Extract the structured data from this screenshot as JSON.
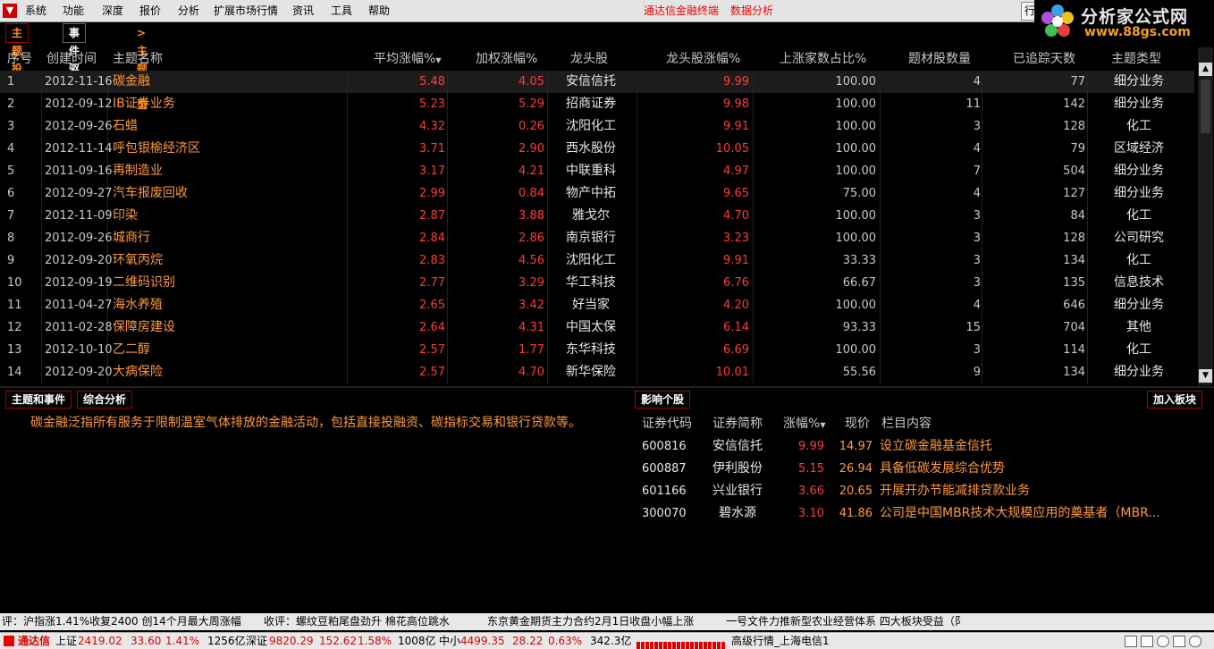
{
  "menubar": {
    "items": [
      "系统",
      "功能",
      "深度",
      "报价",
      "分析",
      "扩展市场行情",
      "资讯",
      "工具",
      "帮助"
    ],
    "center_title": "通达信金融终端",
    "center_sub": "数据分析",
    "hangqing": "行"
  },
  "brand": {
    "name": "分析家公式网",
    "url": "www.88gs.com"
  },
  "tabs": {
    "theme_invest": "主题投资",
    "event_driven": "事件驱动",
    "theme_type": ">主题类型"
  },
  "table": {
    "headers": [
      "序号",
      "创建时间",
      "主题名称",
      "平均涨幅%",
      "加权涨幅%",
      "龙头股",
      "龙头股涨幅%",
      "上涨家数占比%",
      "题材股数量",
      "已追踪天数",
      "主题类型"
    ],
    "rows": [
      {
        "no": "1",
        "date": "2012-11-16",
        "name": "碳金融",
        "avg": "5.48",
        "wavg": "4.05",
        "lead": "安信信托",
        "lead_pct": "9.99",
        "up_ratio": "100.00",
        "count": "4",
        "days": "77",
        "type": "细分业务"
      },
      {
        "no": "2",
        "date": "2012-09-12",
        "name": "IB证券业务",
        "avg": "5.23",
        "wavg": "5.29",
        "lead": "招商证券",
        "lead_pct": "9.98",
        "up_ratio": "100.00",
        "count": "11",
        "days": "142",
        "type": "细分业务"
      },
      {
        "no": "3",
        "date": "2012-09-26",
        "name": "石蜡",
        "avg": "4.32",
        "wavg": "0.26",
        "lead": "沈阳化工",
        "lead_pct": "9.91",
        "up_ratio": "100.00",
        "count": "3",
        "days": "128",
        "type": "化工"
      },
      {
        "no": "4",
        "date": "2012-11-14",
        "name": "呼包银榆经济区",
        "avg": "3.71",
        "wavg": "2.90",
        "lead": "西水股份",
        "lead_pct": "10.05",
        "up_ratio": "100.00",
        "count": "4",
        "days": "79",
        "type": "区域经济"
      },
      {
        "no": "5",
        "date": "2011-09-16",
        "name": "再制造业",
        "avg": "3.17",
        "wavg": "4.21",
        "lead": "中联重科",
        "lead_pct": "4.97",
        "up_ratio": "100.00",
        "count": "7",
        "days": "504",
        "type": "细分业务"
      },
      {
        "no": "6",
        "date": "2012-09-27",
        "name": "汽车报废回收",
        "avg": "2.99",
        "wavg": "0.84",
        "lead": "物产中拓",
        "lead_pct": "9.65",
        "up_ratio": "75.00",
        "count": "4",
        "days": "127",
        "type": "细分业务"
      },
      {
        "no": "7",
        "date": "2012-11-09",
        "name": "印染",
        "avg": "2.87",
        "wavg": "3.88",
        "lead": "雅戈尔",
        "lead_pct": "4.70",
        "up_ratio": "100.00",
        "count": "3",
        "days": "84",
        "type": "化工"
      },
      {
        "no": "8",
        "date": "2012-09-26",
        "name": "城商行",
        "avg": "2.84",
        "wavg": "2.86",
        "lead": "南京银行",
        "lead_pct": "3.23",
        "up_ratio": "100.00",
        "count": "3",
        "days": "128",
        "type": "公司研究"
      },
      {
        "no": "9",
        "date": "2012-09-20",
        "name": "环氧丙烷",
        "avg": "2.83",
        "wavg": "4.56",
        "lead": "沈阳化工",
        "lead_pct": "9.91",
        "up_ratio": "33.33",
        "count": "3",
        "days": "134",
        "type": "化工"
      },
      {
        "no": "10",
        "date": "2012-09-19",
        "name": "二维码识别",
        "avg": "2.77",
        "wavg": "3.29",
        "lead": "华工科技",
        "lead_pct": "6.76",
        "up_ratio": "66.67",
        "count": "3",
        "days": "135",
        "type": "信息技术"
      },
      {
        "no": "11",
        "date": "2011-04-27",
        "name": "海水养殖",
        "avg": "2.65",
        "wavg": "3.42",
        "lead": "好当家",
        "lead_pct": "4.20",
        "up_ratio": "100.00",
        "count": "4",
        "days": "646",
        "type": "细分业务"
      },
      {
        "no": "12",
        "date": "2011-02-28",
        "name": "保障房建设",
        "avg": "2.64",
        "wavg": "4.31",
        "lead": "中国太保",
        "lead_pct": "6.14",
        "up_ratio": "93.33",
        "count": "15",
        "days": "704",
        "type": "其他"
      },
      {
        "no": "13",
        "date": "2012-10-10",
        "name": "乙二醇",
        "avg": "2.57",
        "wavg": "1.77",
        "lead": "东华科技",
        "lead_pct": "6.69",
        "up_ratio": "100.00",
        "count": "3",
        "days": "114",
        "type": "化工"
      },
      {
        "no": "14",
        "date": "2012-09-20",
        "name": "大病保险",
        "avg": "2.57",
        "wavg": "4.70",
        "lead": "新华保险",
        "lead_pct": "10.01",
        "up_ratio": "55.56",
        "count": "9",
        "days": "134",
        "type": "细分业务"
      }
    ]
  },
  "bottom_tabs": {
    "theme_event": "主题和事件",
    "analysis": "综合分析",
    "impact": "影响个股",
    "add_block": "加入板块"
  },
  "description": "碳金融泛指所有服务于限制温室气体排放的金融活动，包括直接投融资、碳指标交易和银行贷款等。",
  "impact": {
    "headers": [
      "证券代码",
      "证券简称",
      "涨幅%",
      "现价",
      "栏目内容"
    ],
    "rows": [
      {
        "code": "600816",
        "name": "安信信托",
        "pct": "9.99",
        "price": "14.97",
        "content": "设立碳金融基金信托"
      },
      {
        "code": "600887",
        "name": "伊利股份",
        "pct": "5.15",
        "price": "26.94",
        "content": "具备低碳发展综合优势"
      },
      {
        "code": "601166",
        "name": "兴业银行",
        "pct": "3.66",
        "price": "20.65",
        "content": "开展开办节能减排贷款业务"
      },
      {
        "code": "300070",
        "name": "碧水源",
        "pct": "3.10",
        "price": "41.86",
        "content": "公司是中国MBR技术大规模应用的奠基者（MBR..."
      }
    ]
  },
  "ticker": [
    "评：沪指涨1.41%收复2400 创14个月最大周涨幅",
    "收评：螺纹豆粕尾盘劲升 棉花高位跳水",
    "东京黄金期货主力合约2月1日收盘小幅上涨",
    "一号文件力推新型农业经营体系 四大板块受益（阝"
  ],
  "status": {
    "app": "通达信",
    "sh_label": "上证",
    "sh_val": "2419.02",
    "sh_chg": "33.60",
    "sh_pct": "1.41%",
    "sh_amt": "1256亿",
    "sz_label": "深证",
    "sz_val": "9820.29",
    "sz_chg": "152.62",
    "sz_pct": "1.58%",
    "sz_amt": "1008亿",
    "zx_label": "中小",
    "zx_val": "4499.35",
    "zx_chg": "28.22",
    "zx_pct": "0.63%",
    "zx_amt": "342.3亿",
    "server": "高级行情_上海电信1"
  },
  "colors": {
    "accent_red": "#ff3b3b",
    "accent_orange": "#ff9a3c",
    "background": "#000000"
  }
}
